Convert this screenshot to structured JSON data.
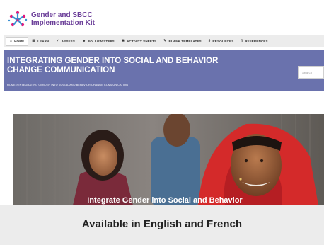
{
  "header": {
    "logo_line1": "Gender and SBCC",
    "logo_line2": "Implementation Kit"
  },
  "nav": {
    "items": [
      {
        "label": "HOME",
        "icon": "home-icon",
        "active": true
      },
      {
        "label": "LEARN",
        "icon": "book-icon"
      },
      {
        "label": "ASSESS",
        "icon": "checkmark-icon"
      },
      {
        "label": "FOLLOW STEPS",
        "icon": "people-icon"
      },
      {
        "label": "ACTIVITY SHEETS",
        "icon": "gear-icon"
      },
      {
        "label": "BLANK TEMPLATES",
        "icon": "pencil-icon"
      },
      {
        "label": "RESOURCES",
        "icon": "paperclip-icon"
      },
      {
        "label": "REFERENCES",
        "icon": "document-icon"
      }
    ]
  },
  "banner": {
    "title": "INTEGRATING GENDER INTO SOCIAL AND BEHAVIOR CHANGE COMMUNICATION",
    "breadcrumb": "HOME > INTEGRATING GENDER INTO SOCIAL AND BEHAVIOR CHANGE COMMUNICATION"
  },
  "search": {
    "placeholder": "Search"
  },
  "hero": {
    "caption": "Integrate Gender into Social and Behavior"
  },
  "caption": {
    "text": "Available in English and French"
  },
  "colors": {
    "brand_purple": "#6a3d98",
    "banner": "#6a72ad",
    "headscarf_red": "#d42a2a"
  }
}
